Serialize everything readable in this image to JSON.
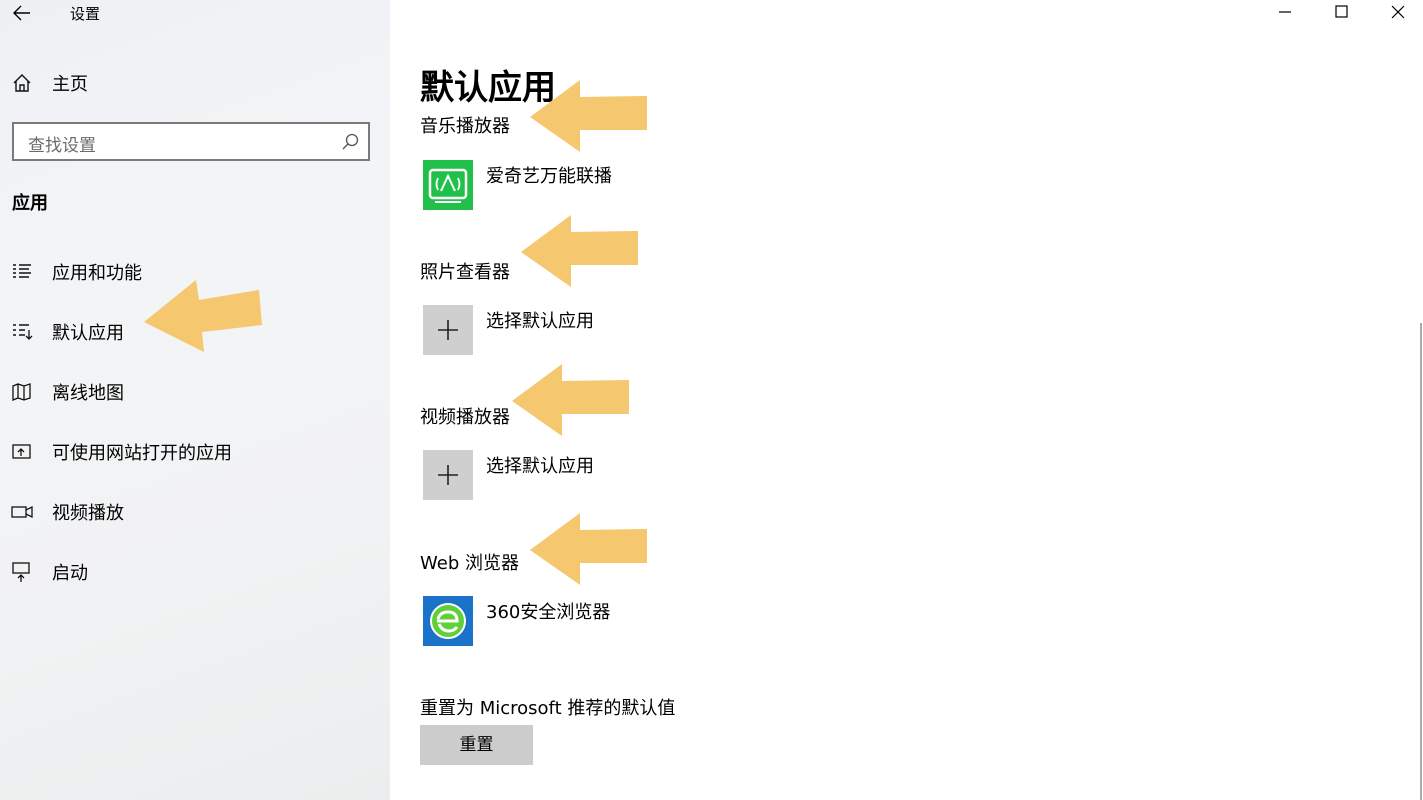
{
  "window": {
    "title": "设置"
  },
  "sidebar": {
    "home_label": "主页",
    "search_placeholder": "查找设置",
    "section_title": "应用",
    "items": [
      {
        "label": "应用和功能",
        "icon": "apps-features-icon"
      },
      {
        "label": "默认应用",
        "icon": "default-apps-icon"
      },
      {
        "label": "离线地图",
        "icon": "offline-maps-icon"
      },
      {
        "label": "可使用网站打开的应用",
        "icon": "apps-for-websites-icon"
      },
      {
        "label": "视频播放",
        "icon": "video-playback-icon"
      },
      {
        "label": "启动",
        "icon": "startup-icon"
      }
    ]
  },
  "main": {
    "title": "默认应用",
    "categories": [
      {
        "label": "音乐播放器",
        "app_name": "爱奇艺万能联播",
        "app_icon": "iqiyi-icon"
      },
      {
        "label": "照片查看器",
        "app_name": "选择默认应用",
        "app_icon": "plus-icon"
      },
      {
        "label": "视频播放器",
        "app_name": "选择默认应用",
        "app_icon": "plus-icon"
      },
      {
        "label": "Web 浏览器",
        "app_name": "360安全浏览器",
        "app_icon": "360-browser-icon"
      }
    ],
    "reset_label": "重置为 Microsoft 推荐的默认值",
    "reset_button": "重置"
  },
  "colors": {
    "annotation_arrow": "#f5c76e",
    "sidebar_bg": "#f1f2f3",
    "tile_gray": "#cfcfcf",
    "iqiyi_green": "#21c04a",
    "browser_blue": "#1a73c9"
  }
}
